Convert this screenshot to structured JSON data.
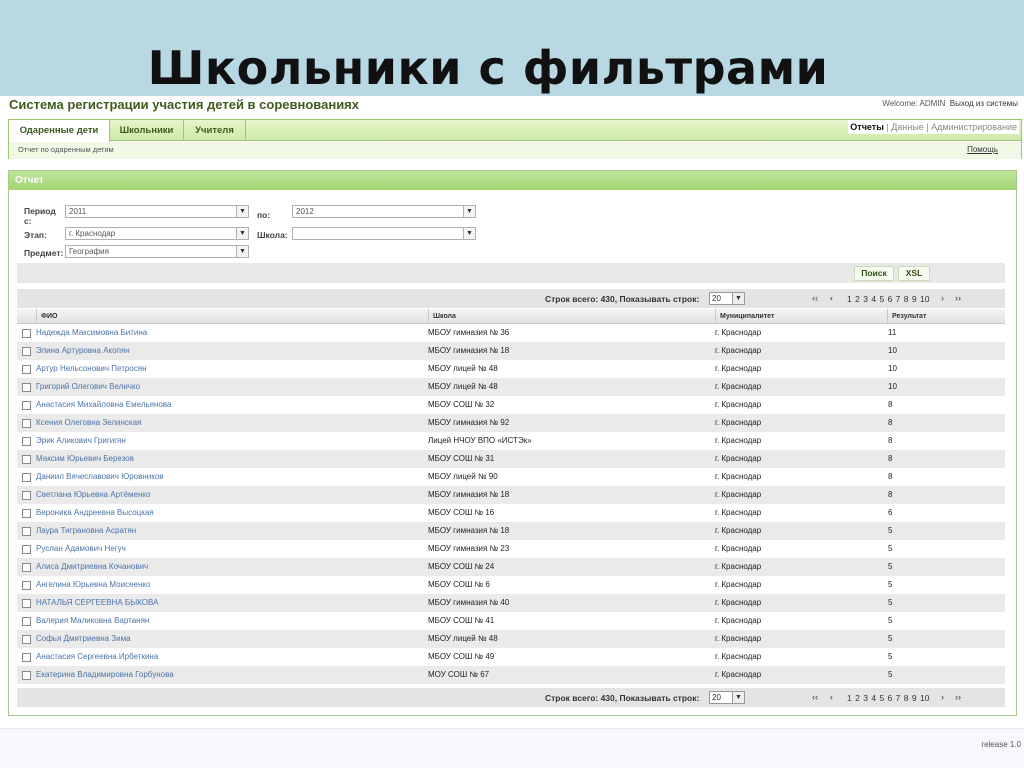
{
  "slide": {
    "title": "Школьники с фильтрами"
  },
  "app": {
    "title": "Система регистрации участия детей в соревнованиях",
    "welcome": "Welcome: ADMIN",
    "logout": "Выход из системы"
  },
  "nav": {
    "tabs": [
      {
        "label": "Одаренные дети"
      },
      {
        "label": "Школьники"
      },
      {
        "label": "Учителя"
      }
    ],
    "right": {
      "reports": "Отчеты",
      "sep1": "|",
      "data": "Данные",
      "sep2": "|",
      "admin": "Администрирование"
    },
    "breadcrumb": "Отчет по одаренным детям",
    "help": "Помощь"
  },
  "panel": {
    "title": "Отчет",
    "filters": {
      "period_label_1": "Период",
      "period_label_2": "с:",
      "period_from": "2011",
      "to_label": "по:",
      "period_to": "2012",
      "stage_label": "Этап:",
      "stage_value": "г. Краснодар",
      "school_label": "Школа:",
      "school_value": "",
      "subject_label": "Предмет:",
      "subject_value": "География"
    },
    "buttons": {
      "search": "Поиск",
      "xsl": "XSL"
    }
  },
  "pager": {
    "text": "Строк всего: 430, Показывать строк:",
    "rows": "20",
    "first": "‹‹",
    "prev": "‹",
    "pages": [
      "1",
      "2",
      "3",
      "4",
      "5",
      "6",
      "7",
      "8",
      "9",
      "10"
    ],
    "next": "›",
    "last": "››"
  },
  "table": {
    "columns": [
      "ФИО",
      "Школа",
      "Муниципалитет",
      "Результат"
    ],
    "rows": [
      [
        "Надежда Максимовна Битина",
        "МБОУ гимназия № 36",
        "г. Краснодар",
        "11"
      ],
      [
        "Элина Артуровна Акопян",
        "МБОУ гимназия № 18",
        "г. Краснодар",
        "10"
      ],
      [
        "Артур Нельсонович Петросян",
        "МБОУ лицей № 48",
        "г. Краснодар",
        "10"
      ],
      [
        "Григорий Олегович Величко",
        "МБОУ лицей № 48",
        "г. Краснодар",
        "10"
      ],
      [
        "Анастасия Михайловна Емельянова",
        "МБОУ СОШ № 32",
        "г. Краснодар",
        "8"
      ],
      [
        "Ксения Олеговна Зелинская",
        "МБОУ гимназия № 92",
        "г. Краснодар",
        "8"
      ],
      [
        "Эрик Аликович Григигян",
        "Лицей НЧОУ ВПО «ИСТЭк»",
        "г. Краснодар",
        "8"
      ],
      [
        "Максим Юрьевич Березов",
        "МБОУ СОШ № 31",
        "г. Краснодар",
        "8"
      ],
      [
        "Даниил Вячеславович Юровников",
        "МБОУ лицей № 90",
        "г. Краснодар",
        "8"
      ],
      [
        "Светлана Юрьевна Артёменко",
        "МБОУ гимназия № 18",
        "г. Краснодар",
        "8"
      ],
      [
        "Вероника Андреевна Высоцкая",
        "МБОУ СОШ № 16",
        "г. Краснодар",
        "6"
      ],
      [
        "Лаура Тиграновна Асратян",
        "МБОУ гимназия № 18",
        "г. Краснодар",
        "5"
      ],
      [
        "Руслан Адамович Негуч",
        "МБОУ гимназия № 23",
        "г. Краснодар",
        "5"
      ],
      [
        "Алиса Дмитриевна Кочанович",
        "МБОУ СОШ № 24",
        "г. Краснодар",
        "5"
      ],
      [
        "Ангелина Юрьевна Моисеенко",
        "МБОУ СОШ № 6",
        "г. Краснодар",
        "5"
      ],
      [
        "НАТАЛЬЯ СЕРГЕЕВНА БЫКОВА",
        "МБОУ гимназия № 40",
        "г. Краснодар",
        "5"
      ],
      [
        "Валерия Маликовна Вартанян",
        "МБОУ СОШ № 41",
        "г. Краснодар",
        "5"
      ],
      [
        "Софья Дмитриевна Зима",
        "МБОУ лицей № 48",
        "г. Краснодар",
        "5"
      ],
      [
        "Анастасия Сергеевна Ирбеткина",
        "МБОУ СОШ № 49",
        "г. Краснодар",
        "5"
      ],
      [
        "Екатерина Владимировна Горбунова",
        "МОУ СОШ № 67",
        "г. Краснодар",
        "5"
      ]
    ]
  },
  "footer": {
    "release": "release 1.0"
  }
}
